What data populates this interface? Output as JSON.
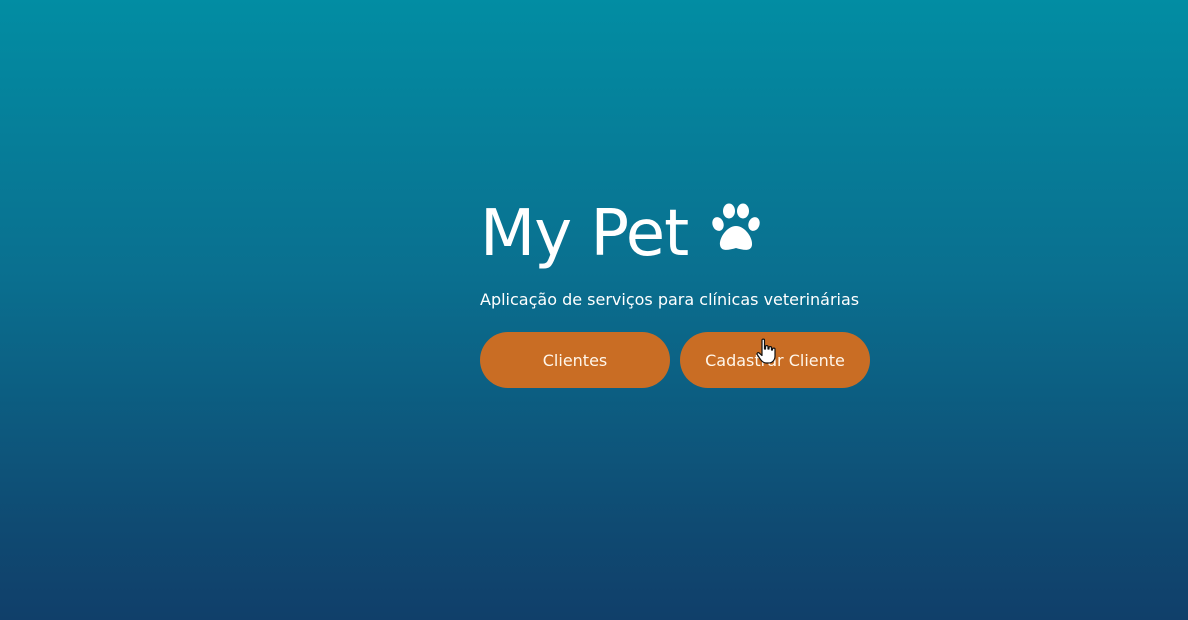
{
  "hero": {
    "title": "My Pet",
    "title_icon": "paw-icon",
    "subtitle": "Aplicação de serviços para clínicas veterinárias"
  },
  "actions": {
    "clients_label": "Clientes",
    "register_client_label": "Cadastrar Cliente"
  },
  "colors": {
    "background_top": "#028da3",
    "background_bottom": "#103f6a",
    "button": "#c96d24",
    "text": "#ffffff"
  },
  "pointer": "hand-pointer-icon"
}
